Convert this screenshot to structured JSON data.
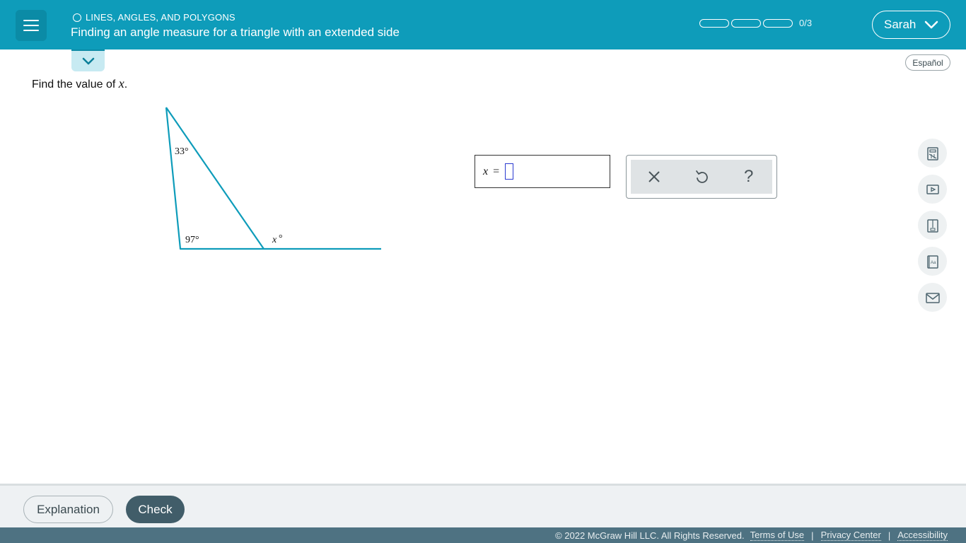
{
  "header": {
    "topic": "LINES, ANGLES, AND POLYGONS",
    "title": "Finding an angle measure for a triangle with an extended side",
    "progress": {
      "completed": 0,
      "total": 3,
      "label": "0/3"
    },
    "user_name": "Sarah",
    "accent_color": "#0e9cba"
  },
  "language_button": "Español",
  "problem": {
    "prompt_text": "Find the value of ",
    "prompt_var": "x",
    "prompt_end": ".",
    "angle_top": "33°",
    "angle_bottom_left": "97°",
    "angle_exterior_var": "x",
    "angle_exterior_deg": "°"
  },
  "answer": {
    "var": "x",
    "equals": "="
  },
  "tools": {
    "clear_icon": "close-icon",
    "undo_icon": "undo-icon",
    "help_icon": "help-icon",
    "help_symbol": "?"
  },
  "side_tools": [
    "calculator-icon",
    "video-icon",
    "textbook-icon",
    "glossary-icon",
    "mail-icon"
  ],
  "footer": {
    "explanation_label": "Explanation",
    "check_label": "Check",
    "check_color": "#415d69"
  },
  "legal": {
    "copyright": "© 2022 McGraw Hill LLC. All Rights Reserved.",
    "terms": "Terms of Use",
    "privacy": "Privacy Center",
    "accessibility": "Accessibility",
    "separator": "|"
  }
}
